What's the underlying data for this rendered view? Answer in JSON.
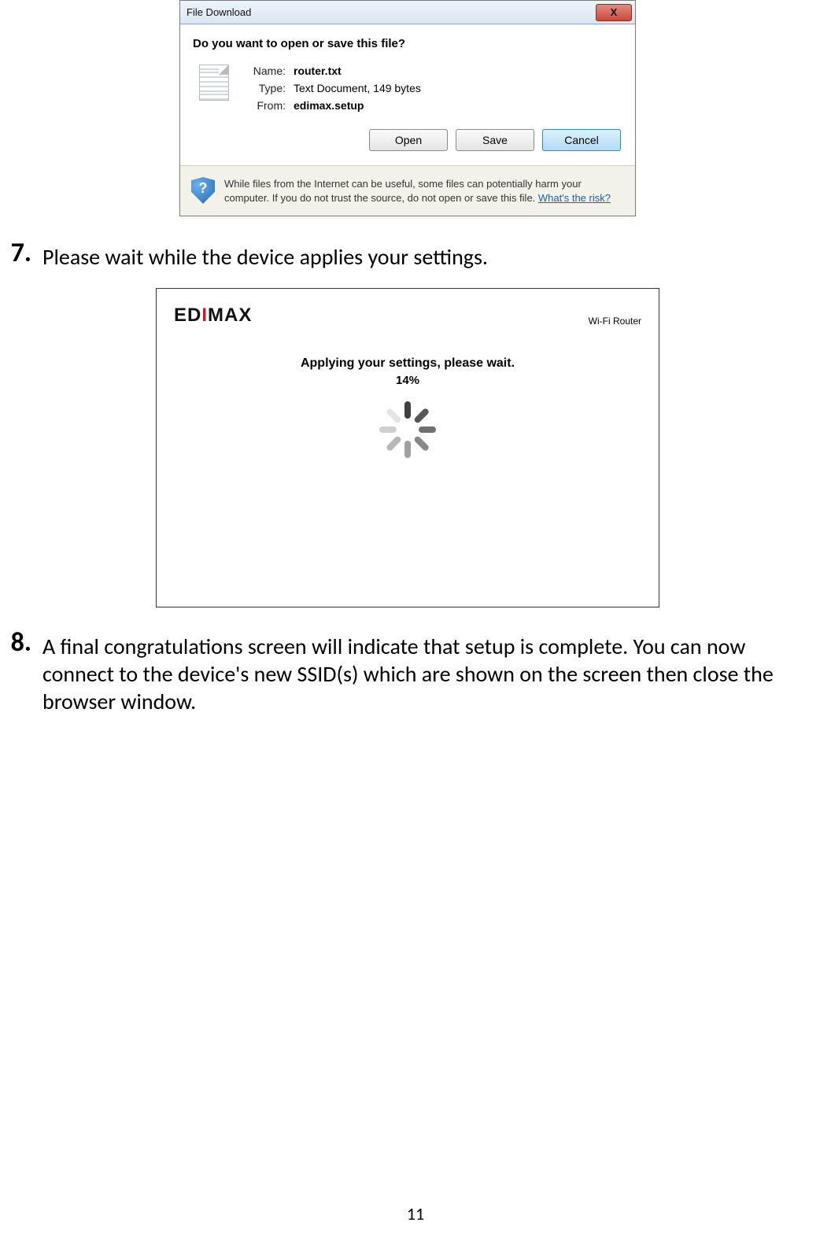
{
  "dialog": {
    "title": "File Download",
    "question": "Do you want to open or save this file?",
    "name_label": "Name:",
    "name_value": "router.txt",
    "type_label": "Type:",
    "type_value": "Text Document, 149 bytes",
    "from_label": "From:",
    "from_value": "edimax.setup",
    "open_btn": "Open",
    "save_btn": "Save",
    "cancel_btn": "Cancel",
    "close_glyph": "X",
    "shield_glyph": "?",
    "warn_text": "While files from the Internet can be useful, some files can potentially harm your computer. If you do not trust the source, do not open or save this file. ",
    "risk_link": "What's the risk?"
  },
  "step7": {
    "num": "7.",
    "text": "Please wait while the device applies your settings."
  },
  "router": {
    "logo": "EDIMAX",
    "type": "Wi-Fi Router",
    "msg": "Applying your settings, please wait.",
    "pct": "14%"
  },
  "step8": {
    "num": "8.",
    "text": "A final congratulations screen will indicate that setup is complete. You can now connect to the device's new SSID(s) which are shown on the screen then close the browser window."
  },
  "pagenum": "11"
}
